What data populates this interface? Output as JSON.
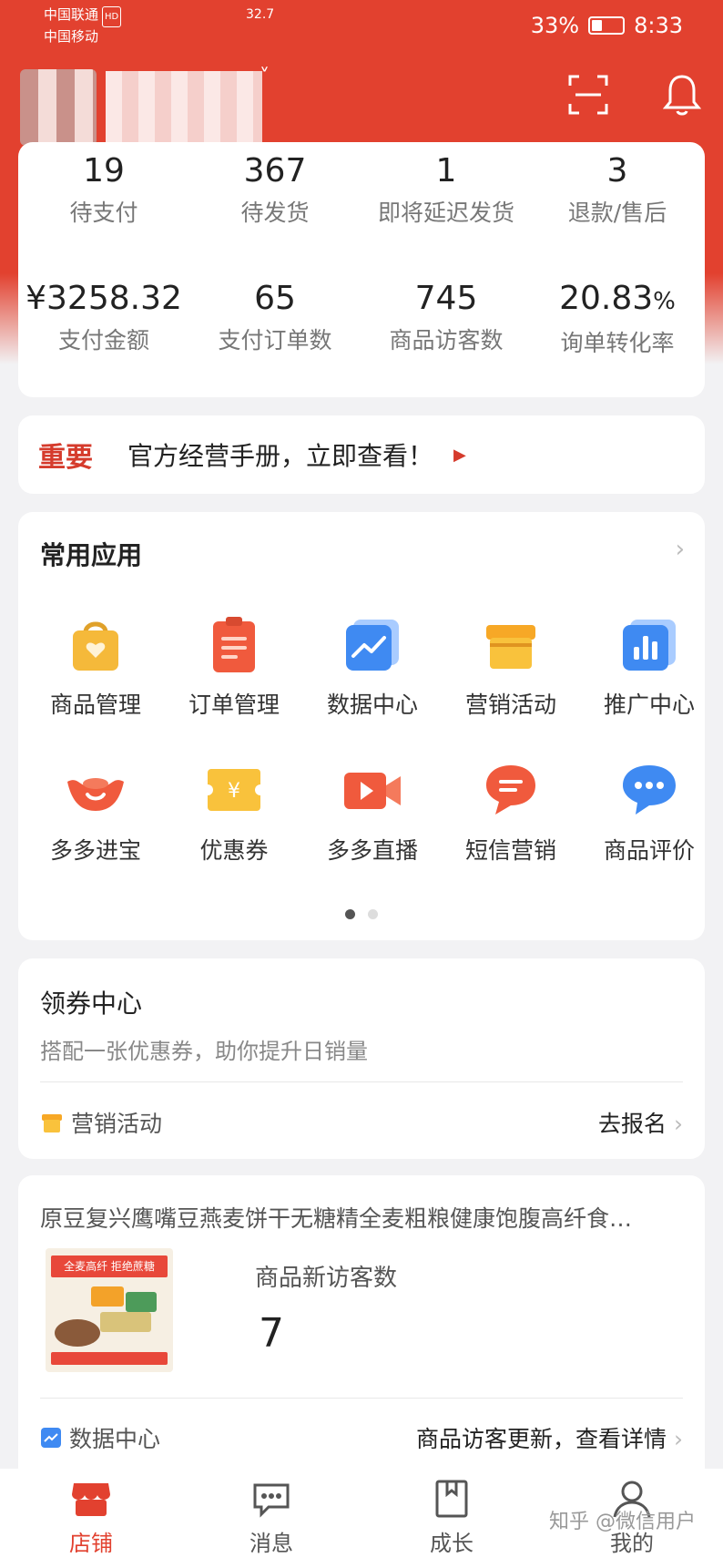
{
  "status_bar": {
    "carrier_1": "中国联通",
    "hd_badge": "HD",
    "carrier_2": "中国移动",
    "net_speed": "32.7",
    "battery": "33%",
    "battery_level": 0.33,
    "time": "8:33"
  },
  "stats": [
    {
      "value": "19",
      "label": "待支付"
    },
    {
      "value": "367",
      "label": "待发货"
    },
    {
      "value": "1",
      "label": "即将延迟发货"
    },
    {
      "value": "3",
      "label": "退款/售后"
    }
  ],
  "metrics": [
    {
      "value": "¥3258.32",
      "label": "支付金额"
    },
    {
      "value": "65",
      "label": "支付订单数"
    },
    {
      "value": "745",
      "label": "商品访客数"
    },
    {
      "value": "20.83",
      "unit": "%",
      "label": "询单转化率"
    }
  ],
  "notice": {
    "tag": "重要",
    "text": "官方经营手册，立即查看！"
  },
  "apps": {
    "title": "常用应用",
    "more": "›",
    "items": [
      {
        "label": "商品管理",
        "icon": "bag-icon"
      },
      {
        "label": "订单管理",
        "icon": "clipboard-icon"
      },
      {
        "label": "数据中心",
        "icon": "chart-line-icon"
      },
      {
        "label": "营销活动",
        "icon": "gift-box-icon"
      },
      {
        "label": "推广中心",
        "icon": "bar-chart-icon"
      },
      {
        "label": "多多进宝",
        "icon": "ingot-icon"
      },
      {
        "label": "优惠券",
        "icon": "coupon-icon"
      },
      {
        "label": "多多直播",
        "icon": "video-camera-icon"
      },
      {
        "label": "短信营销",
        "icon": "sms-icon"
      },
      {
        "label": "商品评价",
        "icon": "comment-icon"
      }
    ],
    "page_count": 2,
    "active_page": 0
  },
  "coupon": {
    "title": "领券中心",
    "subtitle": "搭配一张优惠券，助你提升日销量",
    "row_label": "营销活动",
    "row_action": "去报名"
  },
  "product": {
    "title": "原豆复兴鹰嘴豆燕麦饼干无糖精全麦粗粮健康饱腹高纤食…",
    "image_text": "全麦高纤 拒绝蔗糖",
    "metric_label": "商品新访客数",
    "metric_value": "7",
    "row_label": "数据中心",
    "row_action": "商品访客更新，查看详情"
  },
  "tabbar": {
    "items": [
      {
        "label": "店铺",
        "icon": "store-icon",
        "active": true
      },
      {
        "label": "消息",
        "icon": "message-icon",
        "active": false
      },
      {
        "label": "成长",
        "icon": "bookmark-icon",
        "active": false
      },
      {
        "label": "我的",
        "icon": "user-icon",
        "active": false
      }
    ],
    "watermark": "知乎 @微信用户"
  },
  "colors": {
    "brand_red": "#e2412f",
    "accent_red": "#d53b2c",
    "page_bg": "#f2f2f4"
  }
}
